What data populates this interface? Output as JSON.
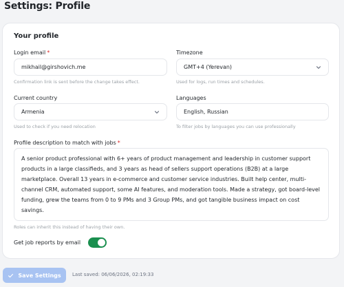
{
  "page": {
    "title": "Settings: Profile"
  },
  "profile": {
    "section_title": "Your profile",
    "login_email": {
      "label": "Login email",
      "required_mark": "*",
      "value": "mikhail@girshovich.me",
      "help": "Confirmation link is sent before the change takes effect."
    },
    "timezone": {
      "label": "Timezone",
      "value": "GMT+4 (Yerevan)",
      "help": "Used for logs, run times and schedules."
    },
    "current_country": {
      "label": "Current country",
      "value": "Armenia",
      "help": "Used to check if you need relocation"
    },
    "languages": {
      "label": "Languages",
      "value": "English, Russian",
      "help": "To filter jobs by languages you can use professionally"
    },
    "description": {
      "label": "Profile description to match with jobs",
      "required_mark": "*",
      "value": "A senior product professional with 6+ years of product management and leadership in customer support products in a large classifieds, and 3 years as head of sellers support operations (B2B) at a large marketplace. Overall 13 years in e-commerce and customer service industries. Built help center, multi-channel CRM, automated support, some AI features, and moderation tools. Made a strategy, got board-level funding, grew the teams from 0 to 9 PMs and 3 Group PMs, and got tangible business impact on cost savings.",
      "help": "Roles can inherit this instead of having their own."
    },
    "job_reports": {
      "label": "Get job reports by email",
      "enabled": true
    }
  },
  "footer": {
    "save_label": "Save Settings",
    "last_saved": "Last saved: 06/06/2026, 02:19:33"
  },
  "colors": {
    "toggle_on": "#1a8f4f",
    "save_button": "#a8c3f2",
    "required": "#dc2626"
  },
  "icons": {
    "timezone_select": "chevron-down-icon",
    "country_select": "chevron-down-icon",
    "save_button": "check-icon"
  }
}
